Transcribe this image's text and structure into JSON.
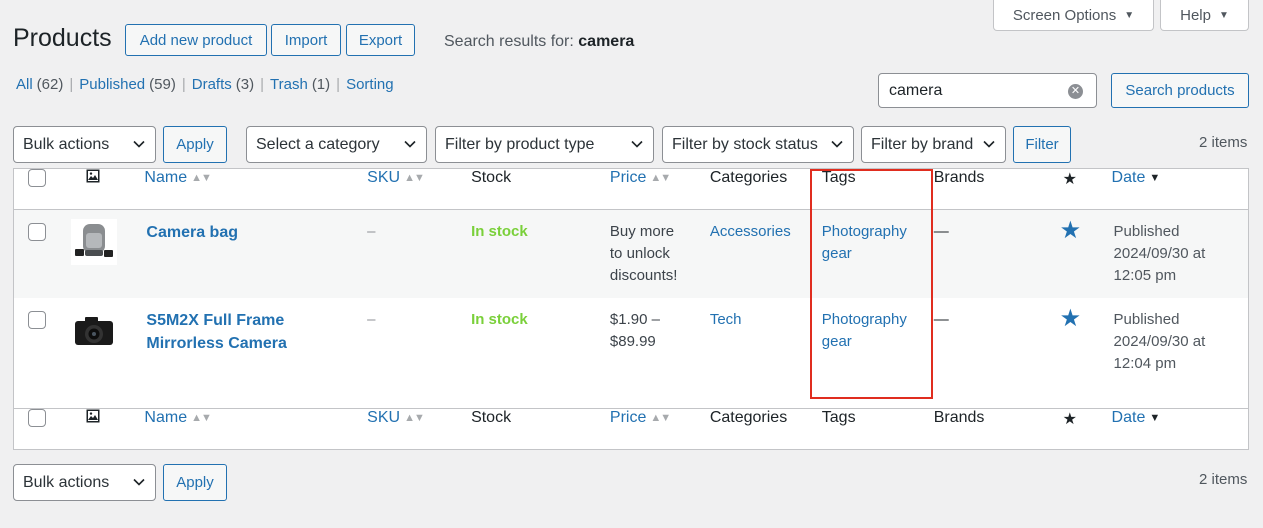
{
  "header": {
    "screen_options": "Screen Options",
    "help": "Help",
    "title": "Products",
    "buttons": {
      "add": "Add new product",
      "import": "Import",
      "export": "Export"
    },
    "search_results_label": "Search results for:",
    "search_term": "camera"
  },
  "views": [
    {
      "label": "All",
      "count": "(62)"
    },
    {
      "label": "Published",
      "count": "(59)"
    },
    {
      "label": "Drafts",
      "count": "(3)"
    },
    {
      "label": "Trash",
      "count": "(1)"
    },
    {
      "label": "Sorting",
      "count": ""
    }
  ],
  "search": {
    "value": "camera",
    "button": "Search products"
  },
  "filters": {
    "bulk_actions": "Bulk actions",
    "apply": "Apply",
    "category": "Select a category",
    "product_type": "Filter by product type",
    "stock_status": "Filter by stock status",
    "brand": "Filter by brand",
    "filter_button": "Filter",
    "items_count": "2 items"
  },
  "columns": {
    "name": "Name",
    "sku": "SKU",
    "stock": "Stock",
    "price": "Price",
    "categories": "Categories",
    "tags": "Tags",
    "brands": "Brands",
    "date": "Date"
  },
  "products": [
    {
      "name_line1": "Camera bag",
      "name_line2": "",
      "sku": "–",
      "stock": "In stock",
      "price_line1": "Buy more",
      "price_line2": "to unlock",
      "price_line3": "discounts!",
      "category": "Accessories",
      "tag_line1": "Photography",
      "tag_line2": "gear",
      "brands": "—",
      "date_status": "Published",
      "date_line2": "2024/09/30 at",
      "date_line3": "12:05 pm"
    },
    {
      "name_line1": "S5M2X Full Frame",
      "name_line2": "Mirrorless Camera",
      "sku": "–",
      "stock": "In stock",
      "price_line1": "$1.90 –",
      "price_line2": "$89.99",
      "price_line3": "",
      "category": "Tech",
      "tag_line1": "Photography",
      "tag_line2": "gear",
      "brands": "—",
      "date_status": "Published",
      "date_line2": "2024/09/30 at",
      "date_line3": "12:04 pm"
    }
  ],
  "colors": {
    "accent": "#2271b1",
    "in_stock": "#7ad03a",
    "highlight": "#e02d1f"
  }
}
